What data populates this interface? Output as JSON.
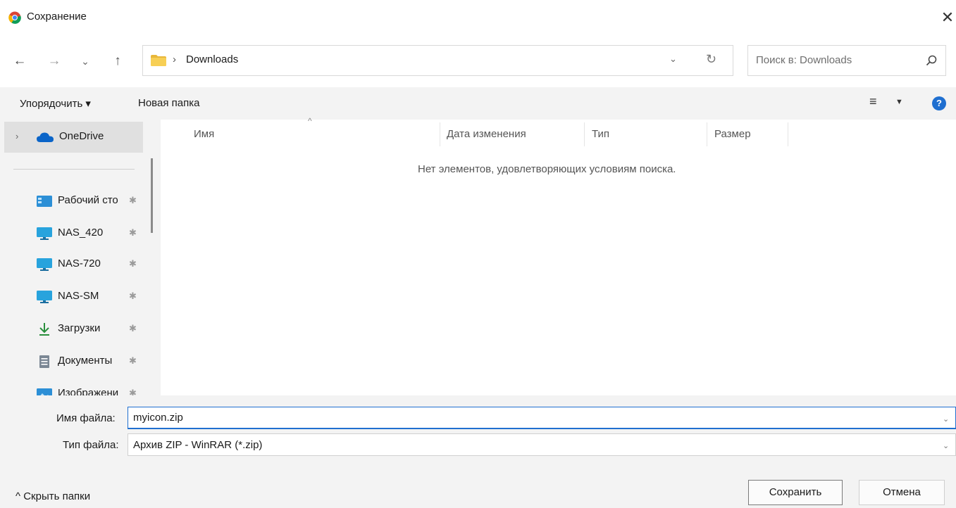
{
  "window": {
    "title": "Сохранение",
    "close_glyph": "✕"
  },
  "navigation": {
    "back_glyph": "←",
    "forward_glyph": "→",
    "recent_glyph": "⌄",
    "up_glyph": "↑",
    "breadcrumb_separator": "›",
    "address_path": "Downloads",
    "address_dropdown_glyph": "⌄",
    "refresh_glyph": "↻",
    "search_placeholder": "Поиск в: Downloads"
  },
  "commandbar": {
    "organize_label": "Упорядочить ▾",
    "new_folder_label": "Новая папка",
    "view_glyph": "≡",
    "view_caret": "▼",
    "help_glyph": "?"
  },
  "sidebar": {
    "onedrive": {
      "chevron": "›",
      "label": "OneDrive"
    },
    "items": [
      {
        "label": "Рабочий сто",
        "icon": "desktop-icon",
        "pinned": true
      },
      {
        "label": "NAS_420",
        "icon": "network-drive-icon",
        "pinned": true
      },
      {
        "label": "NAS-720",
        "icon": "network-drive-icon",
        "pinned": true
      },
      {
        "label": "NAS-SM",
        "icon": "network-drive-icon",
        "pinned": true
      },
      {
        "label": "Загрузки",
        "icon": "downloads-icon",
        "pinned": true
      },
      {
        "label": "Документы",
        "icon": "documents-icon",
        "pinned": true
      },
      {
        "label": "Изображени",
        "icon": "pictures-icon",
        "pinned": true
      }
    ],
    "pin_glyph": "✱"
  },
  "filelist": {
    "sort_glyph": "^",
    "columns": [
      "Имя",
      "Дата изменения",
      "Тип",
      "Размер"
    ],
    "empty_message": "Нет элементов, удовлетворяющих условиям поиска."
  },
  "form": {
    "filename_label": "Имя файла:",
    "filename_value": "myicon.zip",
    "filetype_label": "Тип файла:",
    "filetype_value": "Архив ZIP - WinRAR (*.zip)",
    "dropdown_glyph": "⌄"
  },
  "footer": {
    "hide_folders_label": "^  Скрыть папки",
    "save_label": "Сохранить",
    "cancel_label": "Отмена"
  },
  "colors": {
    "accent": "#1f6fd0",
    "panel_bg": "#f3f3f3",
    "selected_bg": "#e0e0e0"
  }
}
